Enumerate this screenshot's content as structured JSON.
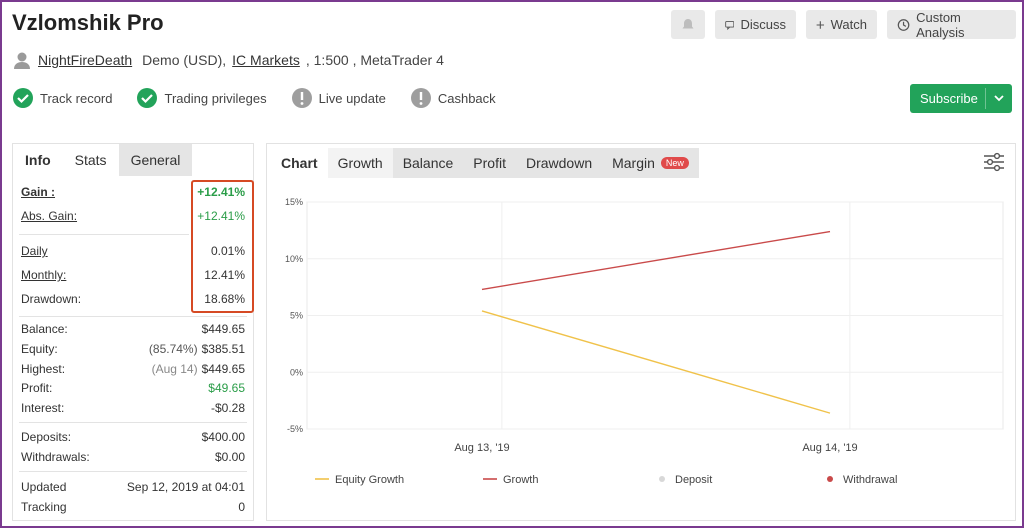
{
  "header": {
    "title": "Vzlomshik Pro",
    "buttons": {
      "discuss": "Discuss",
      "watch": "Watch",
      "custom": "Custom Analysis"
    }
  },
  "account": {
    "user": "NightFireDeath",
    "type": "Demo (USD),",
    "broker": "IC Markets",
    "leverage": ", 1:500 , MetaTrader 4"
  },
  "badges": {
    "track": "Track record",
    "trading": "Trading privileges",
    "live": "Live update",
    "cashback": "Cashback"
  },
  "subscribe_label": "Subscribe",
  "left_tabs": {
    "info": "Info",
    "stats": "Stats",
    "general": "General"
  },
  "info": {
    "gain_label": "Gain :",
    "gain": "+12.41%",
    "abs_gain_label": "Abs. Gain:",
    "abs_gain": "+12.41%",
    "daily_label": "Daily",
    "daily": "0.01%",
    "monthly_label": "Monthly:",
    "monthly": "12.41%",
    "drawdown_label": "Drawdown:",
    "drawdown": "18.68%",
    "balance_label": "Balance:",
    "balance": "$449.65",
    "equity_label": "Equity:",
    "equity_pct": "(85.74%)",
    "equity": "$385.51",
    "highest_label": "Highest:",
    "highest_date": "(Aug 14)",
    "highest": "$449.65",
    "profit_label": "Profit:",
    "profit": "$49.65",
    "interest_label": "Interest:",
    "interest": "-$0.28",
    "deposits_label": "Deposits:",
    "deposits": "$400.00",
    "withdrawals_label": "Withdrawals:",
    "withdrawals": "$0.00",
    "updated_label": "Updated",
    "updated": "Sep 12, 2019 at 04:01",
    "tracking_label": "Tracking",
    "tracking": "0"
  },
  "chart_tabs": {
    "chart": "Chart",
    "growth": "Growth",
    "balance": "Balance",
    "profit": "Profit",
    "drawdown": "Drawdown",
    "margin": "Margin",
    "new": "New"
  },
  "colors": {
    "equity": "#f0c24a",
    "growth": "#c94a4a",
    "deposit": "#d8d8d8",
    "withdrawal": "#c94a4a",
    "green": "#22a35a"
  },
  "chart_data": {
    "type": "line",
    "x": [
      "Aug 13, '19",
      "Aug 14, '19"
    ],
    "yticks": [
      "15%",
      "10%",
      "5%",
      "0%",
      "-5%"
    ],
    "ylim": [
      -5,
      15
    ],
    "series": [
      {
        "name": "Growth",
        "points": [
          [
            0.45,
            7.3
          ],
          [
            1.5,
            12.4
          ]
        ]
      },
      {
        "name": "Equity Growth",
        "points": [
          [
            0.45,
            5.4
          ],
          [
            1.5,
            -3.6
          ]
        ]
      }
    ],
    "legend": [
      "Equity Growth",
      "Growth",
      "Deposit",
      "Withdrawal"
    ],
    "grid": true,
    "legend_position": "bottom"
  }
}
